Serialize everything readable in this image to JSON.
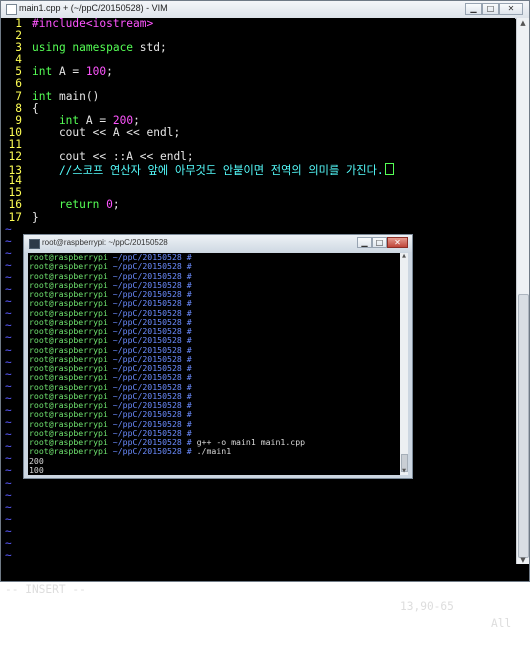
{
  "window": {
    "title": "main1.cpp + (~/ppC/20150528) - VIM"
  },
  "editor": {
    "lines": [
      {
        "num": "1",
        "parts": [
          {
            "t": "#include<iostream>",
            "c": "#ff55ff"
          }
        ]
      },
      {
        "num": "2",
        "parts": []
      },
      {
        "num": "3",
        "parts": [
          {
            "t": "using ",
            "c": "#55ff55"
          },
          {
            "t": "namespace ",
            "c": "#55ff55"
          },
          {
            "t": "std;",
            "c": "#e6e6e6"
          }
        ]
      },
      {
        "num": "4",
        "parts": []
      },
      {
        "num": "5",
        "parts": [
          {
            "t": "int ",
            "c": "#55ff55"
          },
          {
            "t": "A = ",
            "c": "#e6e6e6"
          },
          {
            "t": "100",
            "c": "#ff55ff"
          },
          {
            "t": ";",
            "c": "#e6e6e6"
          }
        ]
      },
      {
        "num": "6",
        "parts": []
      },
      {
        "num": "7",
        "parts": [
          {
            "t": "int ",
            "c": "#55ff55"
          },
          {
            "t": "main()",
            "c": "#e6e6e6"
          }
        ]
      },
      {
        "num": "8",
        "parts": [
          {
            "t": "{",
            "c": "#e6e6e6"
          }
        ]
      },
      {
        "num": "9",
        "parts": [
          {
            "t": "    int ",
            "c": "#55ff55"
          },
          {
            "t": "A = ",
            "c": "#e6e6e6"
          },
          {
            "t": "200",
            "c": "#ff55ff"
          },
          {
            "t": ";",
            "c": "#e6e6e6"
          }
        ]
      },
      {
        "num": "10",
        "parts": [
          {
            "t": "    cout << A << endl;",
            "c": "#e6e6e6"
          }
        ]
      },
      {
        "num": "11",
        "parts": []
      },
      {
        "num": "12",
        "parts": [
          {
            "t": "    cout << ::A << endl;",
            "c": "#e6e6e6"
          }
        ]
      },
      {
        "num": "13",
        "parts": [
          {
            "t": "    //스코프 연산자 앞에 아무것도 안붙이면 전역의 의미를 가진다.",
            "c": "#55ffff"
          },
          {
            "t": "cursor",
            "c": "#55ff55"
          }
        ]
      },
      {
        "num": "14",
        "parts": []
      },
      {
        "num": "15",
        "parts": []
      },
      {
        "num": "16",
        "parts": [
          {
            "t": "    return ",
            "c": "#55ff55"
          },
          {
            "t": "0",
            "c": "#ff55ff"
          },
          {
            "t": ";",
            "c": "#e6e6e6"
          }
        ]
      },
      {
        "num": "17",
        "parts": [
          {
            "t": "}",
            "c": "#e6e6e6"
          }
        ]
      }
    ],
    "tilde_lines": 28,
    "tilde_char": "~"
  },
  "status": {
    "mode": "-- INSERT --",
    "position": "13,90-65",
    "percent": "All"
  },
  "terminal": {
    "title": "root@raspberrypi: ~/ppC/20150528",
    "prompt_user": "root@raspberrypi",
    "prompt_path": " ~/ppC/20150528 #",
    "empty_prompts": 20,
    "command_lines": [
      " g++ -o main1 main1.cpp",
      " ./main1"
    ],
    "output_lines": [
      "200",
      "100"
    ]
  },
  "buttons": {
    "minimize": "▁",
    "maximize": "□",
    "close": "✕"
  }
}
